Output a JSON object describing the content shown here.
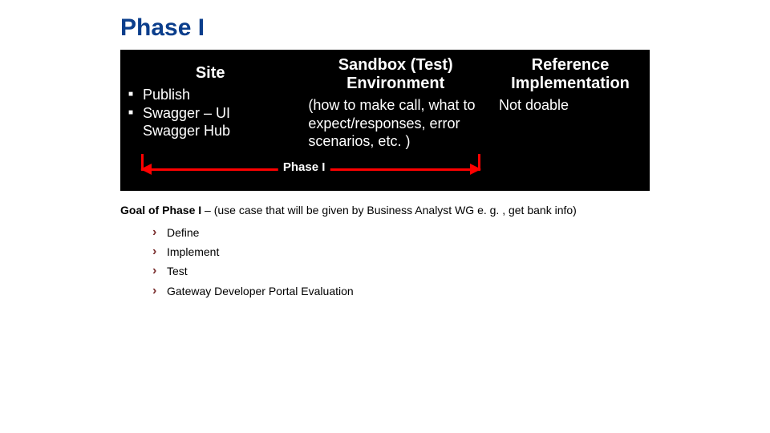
{
  "slide": {
    "heading": "Phase I",
    "table": {
      "site": {
        "header": "Site",
        "items": [
          "Publish",
          "Swagger – UI"
        ],
        "indent_after": "Swagger Hub"
      },
      "sandbox": {
        "header": "Sandbox (Test) Environment",
        "body": "(how to make call, what to expect/responses, error scenarios, etc. )"
      },
      "reference": {
        "header": "Reference Implementation",
        "body": "Not doable"
      }
    },
    "phase_label": "Phase I",
    "goal_lead": "Goal of Phase I",
    "goal_rest": " – (use case that will be given by Business Analyst WG e. g. , get bank info)",
    "goal_items": [
      "Define",
      "Implement",
      "Test",
      "Gateway Developer Portal Evaluation"
    ]
  }
}
